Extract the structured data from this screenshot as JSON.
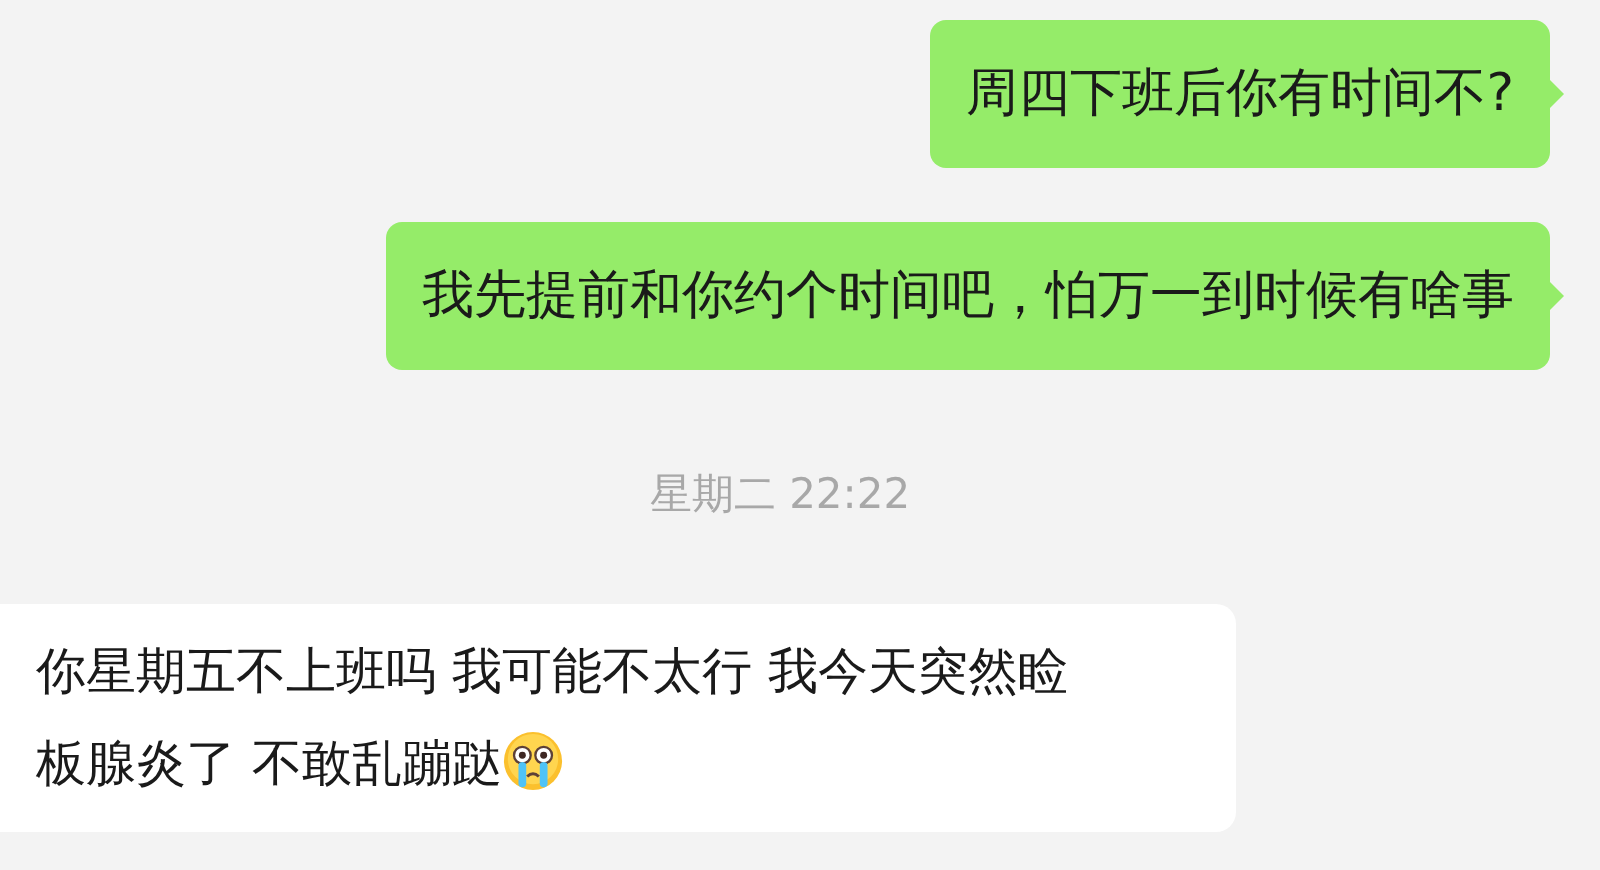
{
  "messages": [
    {
      "kind": "sent",
      "text": "周四下班后你有时间不?"
    },
    {
      "kind": "sent",
      "text": "我先提前和你约个时间吧，怕万一到时候有啥事"
    },
    {
      "kind": "time",
      "text": "星期二 22:22"
    },
    {
      "kind": "received",
      "lines": [
        "你星期五不上班吗 我可能不太行 我今天突然睑",
        "板腺炎了 不敢乱蹦跶"
      ],
      "trailing_emoji": true
    }
  ]
}
